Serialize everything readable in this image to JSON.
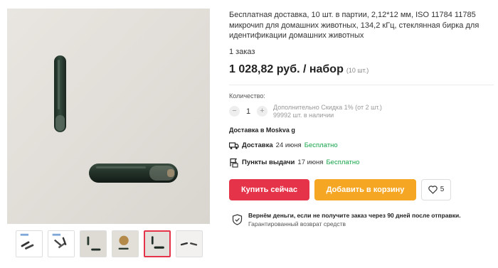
{
  "product": {
    "title": "Бесплатная доставка, 10 шт. в партии, 2,12*12 мм, ISO 11784 11785 микрочип для домашних животных, 134,2 кГц, стеклянная бирка для идентификации домашних животных",
    "orders": "1 заказ",
    "price": "1 028,82 руб. / набор",
    "price_unit": "(10 шт.)"
  },
  "gallery": {
    "main_image": "glass-rfid-tag-photo",
    "thumbnails": [
      {
        "name": "thumb-1",
        "active": false
      },
      {
        "name": "thumb-2",
        "active": false
      },
      {
        "name": "thumb-3",
        "active": false
      },
      {
        "name": "thumb-4",
        "active": false
      },
      {
        "name": "thumb-5",
        "active": true
      },
      {
        "name": "thumb-6",
        "active": false
      }
    ]
  },
  "quantity": {
    "label": "Количество:",
    "minus": "−",
    "value": "1",
    "plus": "+",
    "discount_note": "Дополнительно Скидка 1% (от 2 шт.)",
    "stock_note": "99992 шт. в наличии"
  },
  "shipping": {
    "ship_to": "Доставка в Moskva g",
    "delivery": {
      "label": "Доставка",
      "date": "24 июня",
      "price": "Бесплатно",
      "icon": "truck-icon"
    },
    "pickup": {
      "label": "Пункты выдачи",
      "date": "17 июня",
      "price": "Бесплатно",
      "icon": "pickup-point-icon"
    }
  },
  "actions": {
    "buy_now": "Купить сейчас",
    "add_to_cart": "Добавить в корзину",
    "wishlist_count": "5"
  },
  "guarantee": {
    "title": "Вернём деньги, если не получите заказ через 90 дней после отправки.",
    "subtitle": "Гарантированный возврат средств"
  },
  "colors": {
    "buy": "#e5334a",
    "cart": "#f5a623",
    "free": "#16a34a",
    "active_thumb": "#e5334a"
  }
}
